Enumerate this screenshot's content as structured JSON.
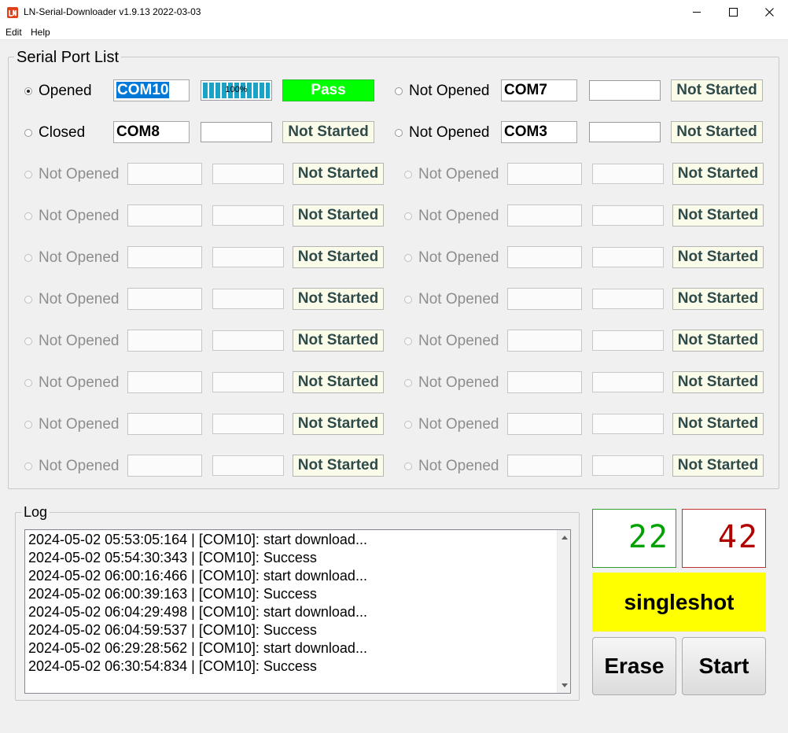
{
  "window": {
    "title": "LN-Serial-Downloader v1.9.13 2022-03-03"
  },
  "menu": {
    "edit": "Edit",
    "help": "Help"
  },
  "ports_group": {
    "title": "Serial Port List"
  },
  "row1": {
    "left": {
      "state": "Opened",
      "port": "COM10",
      "progress_text": "100%",
      "progress_value": 100,
      "status": "Pass"
    },
    "right": {
      "state": "Not Opened",
      "port": "COM7",
      "status": "Not Started"
    }
  },
  "row2": {
    "left": {
      "state": "Closed",
      "port": "COM8",
      "status": "Not Started"
    },
    "right": {
      "state": "Not Opened",
      "port": "COM3",
      "status": "Not Started"
    }
  },
  "disabled_slot": {
    "state": "Not Opened",
    "status": "Not Started"
  },
  "log": {
    "title": "Log",
    "lines": [
      "2024-05-02 05:53:05:164 | [COM10]: start download...",
      "2024-05-02 05:54:30:343 | [COM10]: Success",
      "2024-05-02 06:00:16:466 | [COM10]: start download...",
      "2024-05-02 06:00:39:163 | [COM10]: Success",
      "2024-05-02 06:04:29:498 | [COM10]: start download...",
      "2024-05-02 06:04:59:537 | [COM10]: Success",
      "2024-05-02 06:29:28:562 | [COM10]: start download...",
      "2024-05-02 06:30:54:834 | [COM10]: Success"
    ]
  },
  "counters": {
    "success": "22",
    "fail": "42"
  },
  "mode": {
    "label": "singleshot"
  },
  "buttons": {
    "erase": "Erase",
    "start": "Start"
  },
  "colors": {
    "pass": "#00ff00",
    "not_started_bg": "#fbfbe9",
    "progress": "#1aa3c7",
    "mode_bg": "#ffff00",
    "success_counter": "#00a000",
    "fail_counter": "#b00000",
    "selection": "#0078d7"
  }
}
